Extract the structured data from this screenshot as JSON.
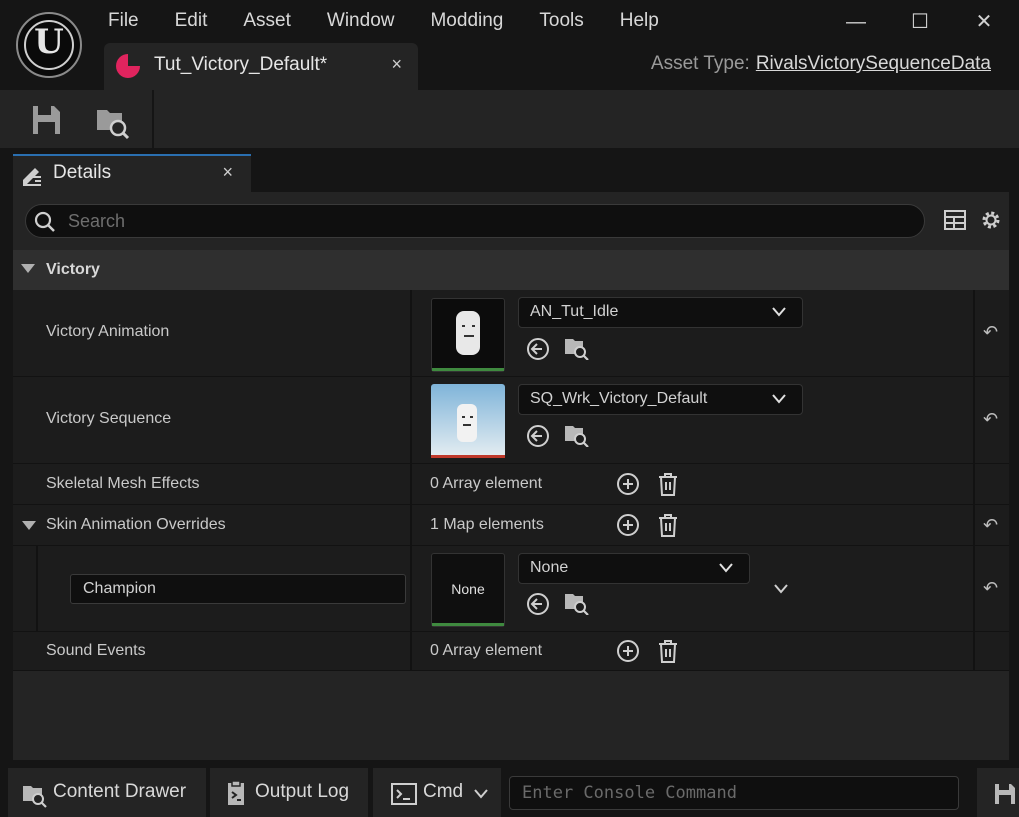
{
  "menu": [
    "File",
    "Edit",
    "Asset",
    "Window",
    "Modding",
    "Tools",
    "Help"
  ],
  "window_controls": {
    "minimize": "—",
    "maximize": "☐",
    "close": "✕"
  },
  "asset_tab": {
    "label": "Tut_Victory_Default*",
    "close": "×"
  },
  "asset_type": {
    "label": "Asset Type:",
    "value": "RivalsVictorySequenceData"
  },
  "details_tab": {
    "label": "Details",
    "close": "×"
  },
  "search": {
    "placeholder": "Search"
  },
  "category": {
    "label": "Victory"
  },
  "rows": {
    "victory_animation": {
      "name": "Victory Animation",
      "value": "AN_Tut_Idle"
    },
    "victory_sequence": {
      "name": "Victory Sequence",
      "value": "SQ_Wrk_Victory_Default"
    },
    "skeletal_mesh_effects": {
      "name": "Skeletal Mesh Effects",
      "count": "0 Array element"
    },
    "skin_animation_overrides": {
      "name": "Skin Animation Overrides",
      "count": "1 Map elements"
    },
    "champion": {
      "key": "Champion",
      "thumb": "None",
      "value": "None"
    },
    "sound_events": {
      "name": "Sound Events",
      "count": "0 Array element"
    }
  },
  "reset_icon": "↶",
  "statusbar": {
    "content_drawer": "Content Drawer",
    "output_log": "Output Log",
    "cmd": "Cmd",
    "console_placeholder": "Enter Console Command"
  },
  "colors": {
    "accent_tab": "#2a6fb0",
    "asset_dot": "#e0245e",
    "anim_bar": "#3f8a3f",
    "seq_bar": "#c0392b"
  }
}
